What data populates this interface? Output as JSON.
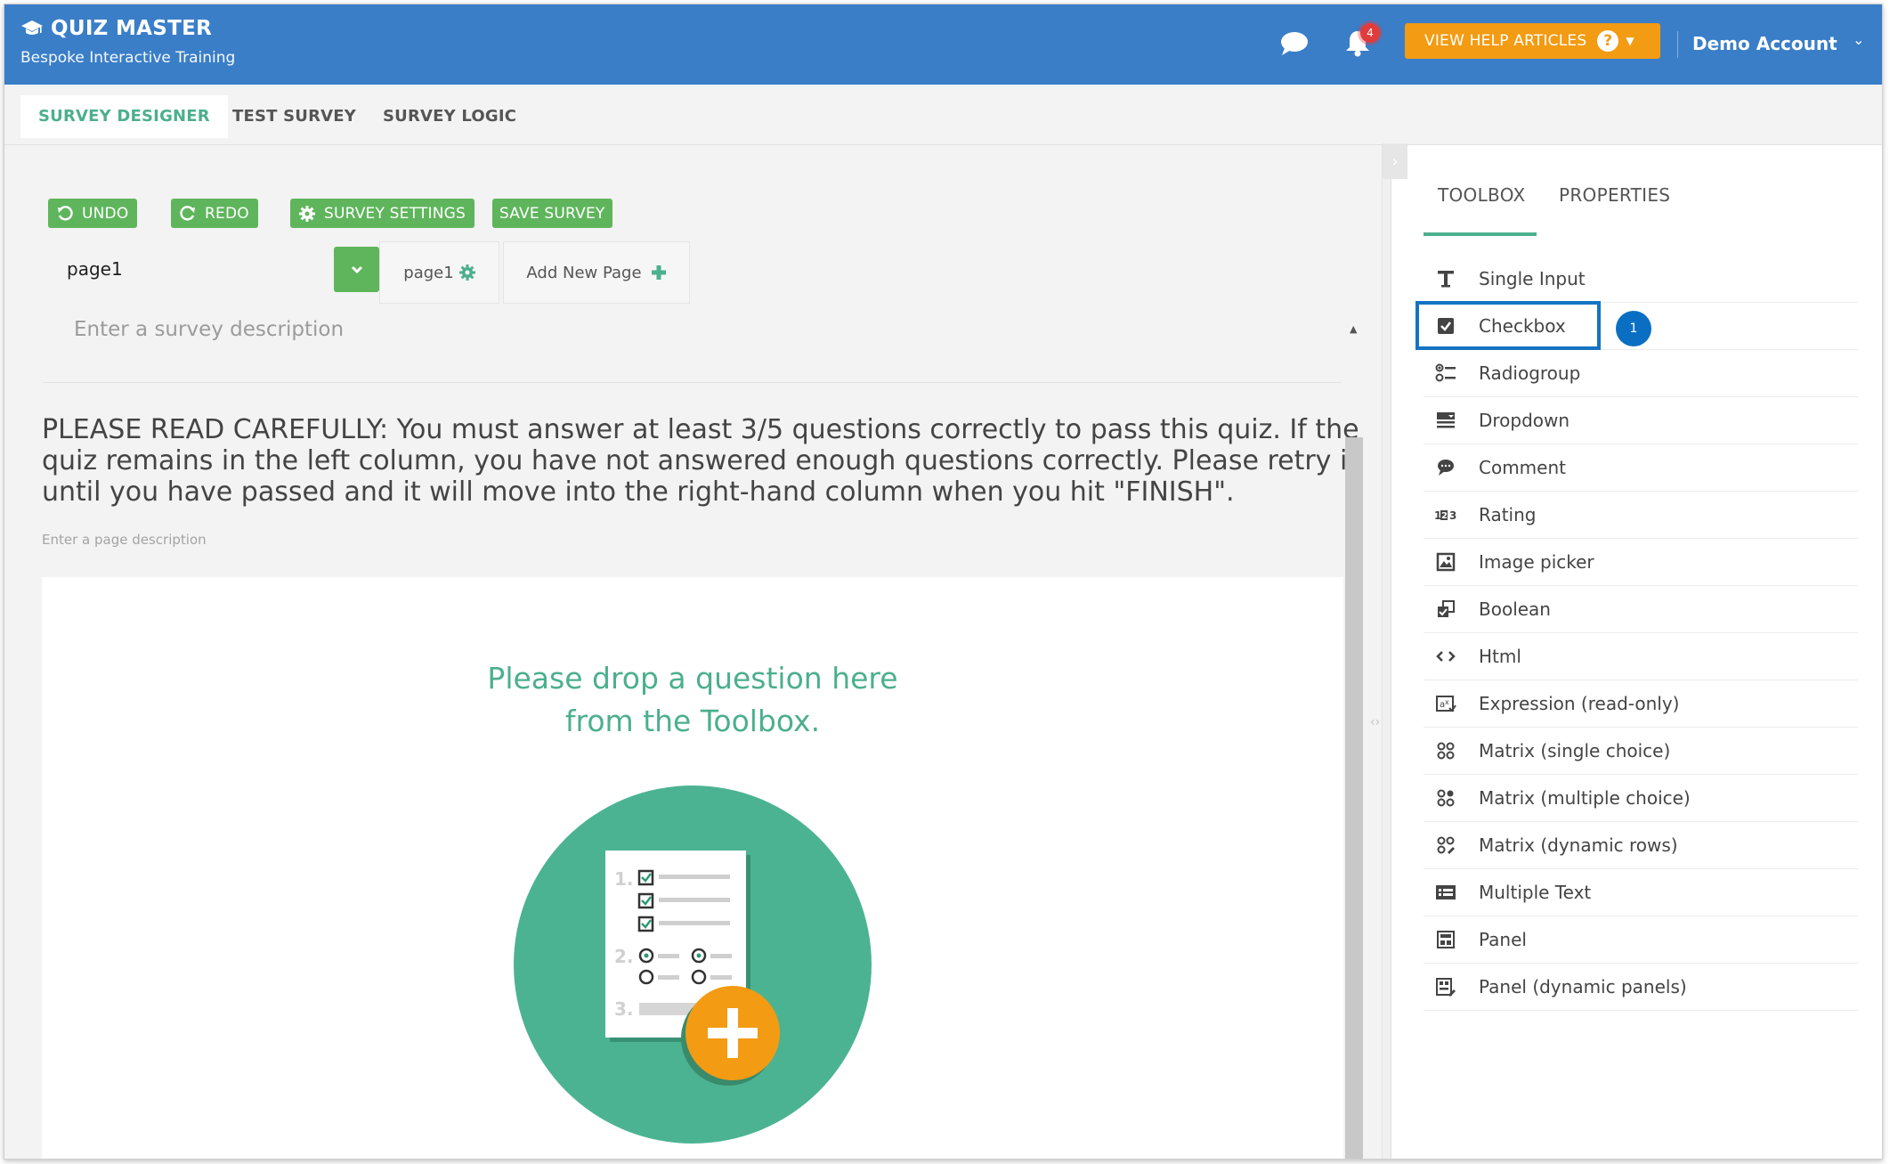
{
  "app": {
    "title": "QUIZ MASTER",
    "subtitle": "Bespoke Interactive Training"
  },
  "header": {
    "chat_icon": "chat-bubble-icon",
    "notifications_icon": "bell-icon",
    "notification_count": "4",
    "help_button_label": "VIEW HELP ARTICLES",
    "help_icon_glyph": "?",
    "account_name": "Demo Account"
  },
  "designer_tabs": [
    {
      "label": "SURVEY DESIGNER",
      "active": true
    },
    {
      "label": "TEST SURVEY",
      "active": false
    },
    {
      "label": "SURVEY LOGIC",
      "active": false
    }
  ],
  "toolbar": {
    "undo_label": "UNDO",
    "redo_label": "REDO",
    "settings_label": "SURVEY SETTINGS",
    "save_label": "SAVE SURVEY"
  },
  "pages": {
    "selected_page": "page1",
    "page_tab_label": "page1",
    "add_page_label": "Add New Page"
  },
  "survey": {
    "description_placeholder": "Enter a survey description",
    "page_title": "PLEASE READ CAREFULLY: You must answer at least 3/5 questions correctly to pass this quiz. If the quiz remains in the left column, you have not answered enough questions correctly. Please retry it until you have passed and it will move into the right-hand column when you hit \"FINISH\".",
    "page_description_placeholder": "Enter a page description",
    "drop_hint_line1": "Please drop a question here",
    "drop_hint_line2": "from the Toolbox.",
    "drop_art_numbers": [
      "1.",
      "2.",
      "3."
    ]
  },
  "sidebar": {
    "tabs": [
      {
        "label": "TOOLBOX",
        "active": true
      },
      {
        "label": "PROPERTIES",
        "active": false
      }
    ],
    "tools": [
      {
        "label": "Single Input",
        "icon": "text-T-icon"
      },
      {
        "label": "Checkbox",
        "icon": "checkbox-icon"
      },
      {
        "label": "Radiogroup",
        "icon": "radiogroup-icon"
      },
      {
        "label": "Dropdown",
        "icon": "dropdown-icon"
      },
      {
        "label": "Comment",
        "icon": "comment-icon"
      },
      {
        "label": "Rating",
        "icon": "rating-icon"
      },
      {
        "label": "Image picker",
        "icon": "image-picker-icon"
      },
      {
        "label": "Boolean",
        "icon": "boolean-icon"
      },
      {
        "label": "Html",
        "icon": "html-code-icon"
      },
      {
        "label": "Expression (read-only)",
        "icon": "expression-icon"
      },
      {
        "label": "Matrix (single choice)",
        "icon": "matrix-single-icon"
      },
      {
        "label": "Matrix (multiple choice)",
        "icon": "matrix-multiple-icon"
      },
      {
        "label": "Matrix (dynamic rows)",
        "icon": "matrix-dynamic-icon"
      },
      {
        "label": "Multiple Text",
        "icon": "multiple-text-icon"
      },
      {
        "label": "Panel",
        "icon": "panel-icon"
      },
      {
        "label": "Panel (dynamic panels)",
        "icon": "panel-dynamic-icon"
      }
    ],
    "highlight_step": "1"
  },
  "colors": {
    "header_blue": "#3a7ec8",
    "accent_green": "#4caf8e",
    "button_green": "#5fb55c",
    "help_orange": "#f39b12",
    "highlight_blue": "#1473c2"
  }
}
